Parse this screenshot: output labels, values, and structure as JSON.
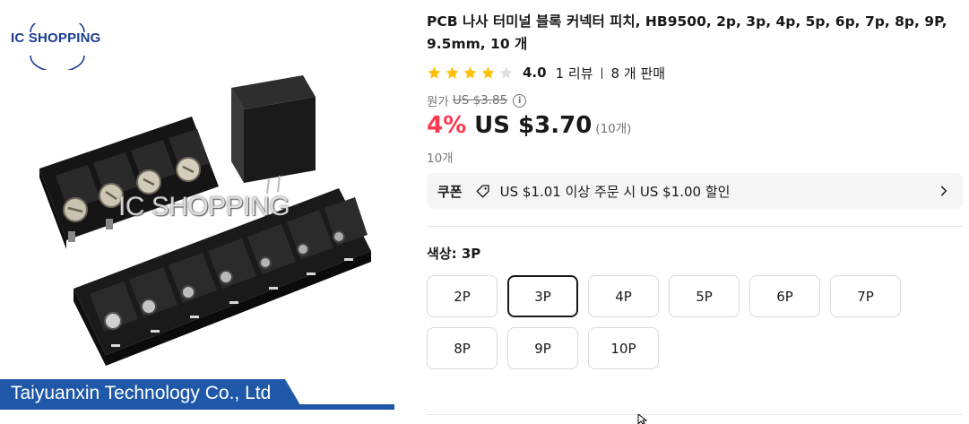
{
  "image": {
    "logo_text": "IC SHOPPING",
    "watermark": "IC SHOPPING",
    "banner_text": "Taiyuanxin Technology Co., Ltd",
    "banner_color": "#1f58a8"
  },
  "product": {
    "title": "PCB 나사 터미널 블록 커넥터 피치, HB9500, 2p, 3p, 4p, 5p, 6p, 7p, 8p, 9P, 9.5mm, 10 개",
    "rating": "4.0",
    "rating_stars": 4,
    "reviews": "1 리뷰",
    "separator": "|",
    "sold": "8 개 판매",
    "original_label": "원가",
    "original_price": "US $3.85",
    "discount": "4%",
    "price": "US $3.70",
    "per_unit": "(10개)",
    "lot": "10개"
  },
  "coupon": {
    "label": "쿠폰",
    "text": "US $1.01 이상 주문 시 US $1.00 할인"
  },
  "color": {
    "label": "색상: 3P",
    "selected": "3P",
    "options": [
      "2P",
      "3P",
      "4P",
      "5P",
      "6P",
      "7P",
      "8P",
      "9P",
      "10P"
    ]
  },
  "colors": {
    "accent": "#fd384f",
    "star": "#ffc107",
    "text": "#191919",
    "muted": "#757575"
  },
  "icons": [
    "info-icon",
    "coupon-tag-icon",
    "chevron-right-icon",
    "star-icon",
    "mouse-cursor-icon"
  ]
}
